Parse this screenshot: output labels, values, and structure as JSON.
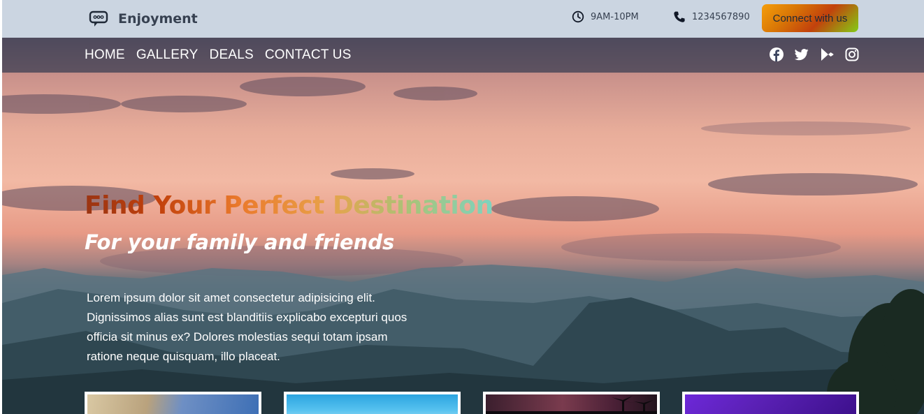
{
  "header": {
    "brand_name": "Enjoyment",
    "hours": "9AM-10PM",
    "phone": "1234567890",
    "cta_label": "Connect with us"
  },
  "nav": {
    "links": [
      "HOME",
      "GALLERY",
      "DEALS",
      "CONTACT US"
    ],
    "social_icons": [
      "facebook-icon",
      "twitter-icon",
      "google-play-icon",
      "instagram-icon"
    ]
  },
  "hero": {
    "headline": "Find Your Perfect Destination",
    "subhead": "For your family and friends",
    "body": "Lorem ipsum dolor sit amet consectetur adipisicing elit. Dignissimos alias sunt est blanditiis explicabo excepturi quos officia sit minus ex? Dolores molestias sequi totam ipsam ratione neque quisquam, illo placeat."
  },
  "colors": {
    "topbar_bg": "#cbd5e1",
    "text_dark": "#374151",
    "cta_gradient": [
      "#f59e0b",
      "#c2410c",
      "#84cc16"
    ],
    "headline_gradient": [
      "#9a3412",
      "#ea7a2c",
      "#7dd3c0"
    ]
  },
  "gallery_cards": [
    {
      "name": "gallery-card-beach"
    },
    {
      "name": "gallery-card-sky"
    },
    {
      "name": "gallery-card-night-palms"
    },
    {
      "name": "gallery-card-purple"
    }
  ]
}
